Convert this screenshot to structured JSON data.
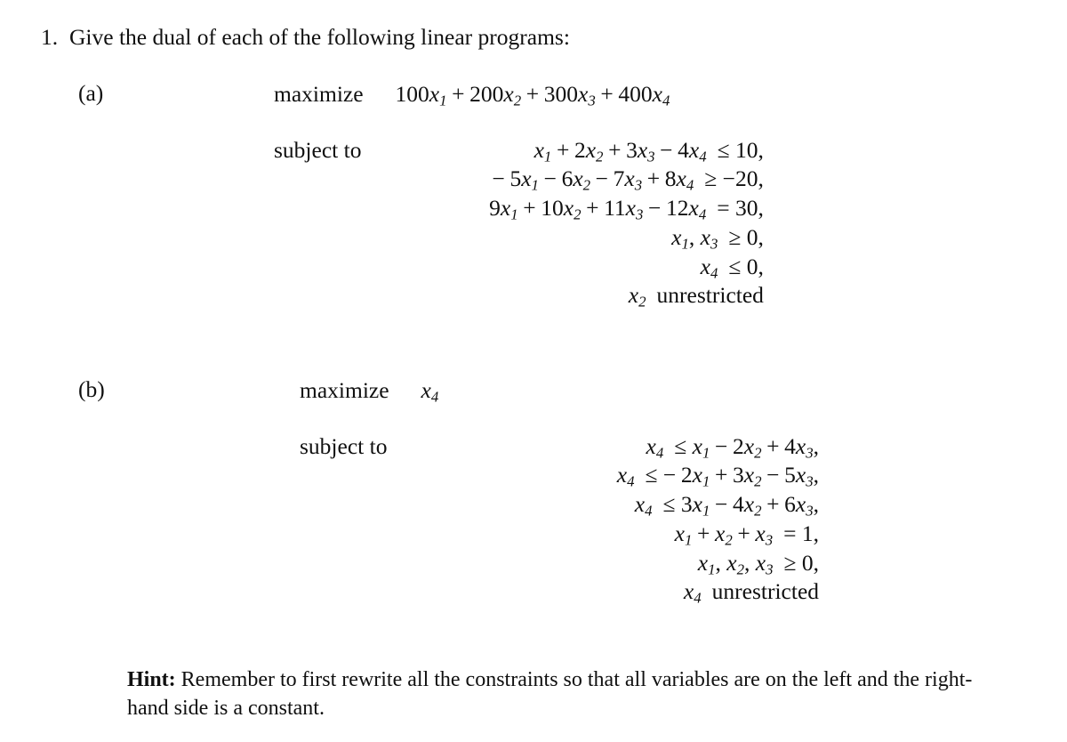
{
  "document": {
    "problem_number": "1.",
    "problem_statement": "Give the dual of each of the following linear programs:"
  },
  "parts": [
    {
      "label": "(a)",
      "objective_keyword": "maximize",
      "constraint_keyword": "subject to",
      "objective": "100x₁ + 200x₂ + 300x₃ + 400x₄",
      "rows": [
        {
          "lhs": "x₁ + 2x₂ + 3x₃ − 4x₄",
          "rel": "≤",
          "rhs": "10,"
        },
        {
          "lhs": "−5x₁ − 6x₂ − 7x₃ + 8x₄",
          "rel": "≥",
          "rhs": "−20,"
        },
        {
          "lhs": "9x₁ + 10x₂ + 11x₃ − 12x₄",
          "rel": "=",
          "rhs": "30,"
        },
        {
          "lhs": "x₁, x₃",
          "rel": "≥",
          "rhs": "0,"
        },
        {
          "lhs": "x₄",
          "rel": "≤",
          "rhs": "0,"
        },
        {
          "lhs": "x₂",
          "rel": "",
          "rhs": "unrestricted"
        }
      ]
    },
    {
      "label": "(b)",
      "objective_keyword": "maximize",
      "constraint_keyword": "subject to",
      "objective": "x₄",
      "rows": [
        {
          "lhs": "x₄",
          "rel": "≤",
          "rhs": "x₁ − 2x₂ + 4x₃,"
        },
        {
          "lhs": "x₄",
          "rel": "≤",
          "rhs": "−2x₁ + 3x₂ − 5x₃,"
        },
        {
          "lhs": "x₄",
          "rel": "≤",
          "rhs": "3x₁ − 4x₂ + 6x₃,"
        },
        {
          "lhs": "x₁ + x₂ + x₃",
          "rel": "=",
          "rhs": "1,"
        },
        {
          "lhs": "x₁, x₂, x₃",
          "rel": "≥",
          "rhs": "0,"
        },
        {
          "lhs": "x₄",
          "rel": "",
          "rhs": "unrestricted"
        }
      ]
    }
  ],
  "hint": {
    "label": "Hint:",
    "text": "Remember to first rewrite all the constraints so that all variables are on the left and the right-hand side is a constant."
  },
  "colors": {
    "background": "#ffffff",
    "text": "#101010"
  }
}
